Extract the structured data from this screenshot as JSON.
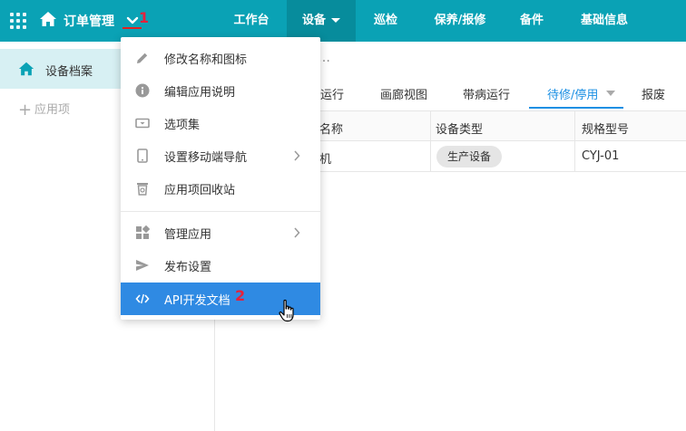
{
  "topbar": {
    "app_title": "订单管理",
    "marker_1": "1",
    "nav": [
      {
        "label": "工作台"
      },
      {
        "label": "设备"
      },
      {
        "label": "巡检"
      },
      {
        "label": "保养/报修"
      },
      {
        "label": "备件"
      },
      {
        "label": "基础信息"
      }
    ]
  },
  "sidebar": {
    "active_item": "设备档案",
    "add_label": "应用项"
  },
  "main": {
    "breadcrumb": "…",
    "tabs": [
      "运行",
      "画廊视图",
      "带病运行",
      "待修/停用",
      "报废"
    ],
    "table": {
      "headers": [
        "名称",
        "设备类型",
        "规格型号"
      ],
      "rows": [
        {
          "name": "机",
          "type": "生产设备",
          "model": "CYJ-01"
        }
      ]
    }
  },
  "menu": {
    "items": [
      {
        "label": "修改名称和图标",
        "icon": "pencil-icon"
      },
      {
        "label": "编辑应用说明",
        "icon": "info-icon"
      },
      {
        "label": "选项集",
        "icon": "select-box-icon"
      },
      {
        "label": "设置移动端导航",
        "icon": "mobile-icon"
      },
      {
        "label": "应用项回收站",
        "icon": "recycle-bin-icon"
      },
      {
        "label": "管理应用",
        "icon": "apps-icon"
      },
      {
        "label": "发布设置",
        "icon": "send-icon"
      },
      {
        "label": "API开发文档",
        "icon": "code-icon"
      }
    ],
    "marker_2": "2"
  },
  "colors": {
    "topbar": "#0aa2b5",
    "topbar_active": "#078c9c",
    "accent": "#1a8fe3",
    "menu_highlight": "#2f8ae3",
    "marker": "#e8203b"
  }
}
